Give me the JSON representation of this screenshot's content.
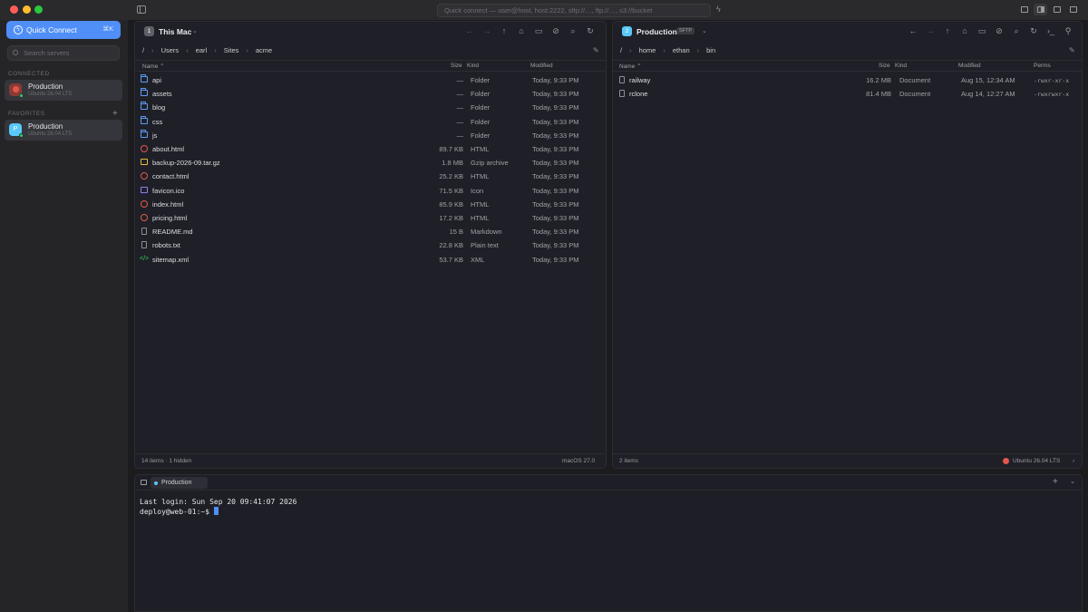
{
  "topbar": {
    "quick_connect_placeholder": "Quick connect — user@host, host:2222, sftp://…, ftp://…, s3://bucket"
  },
  "sidebar": {
    "quick_connect_label": "Quick Connect",
    "quick_connect_shortcut": "⌘K",
    "search_placeholder": "Search servers",
    "connected_header": "CONNECTED",
    "favorites_header": "FAVORITES",
    "connected": [
      {
        "name": "Production",
        "subtitle": "Ubuntu 26.04 LTS",
        "avatar_color": "#e2574c"
      }
    ],
    "favorites": [
      {
        "name": "Production",
        "subtitle": "Ubuntu 26.04 LTS",
        "avatar_letter": "P",
        "avatar_color": "#5ac8fa"
      }
    ]
  },
  "left_pane": {
    "badge": "1",
    "badge_color": "#5f6068",
    "title": "This Mac",
    "breadcrumb": [
      "/",
      "Users",
      "earl",
      "Sites",
      "acme"
    ],
    "columns": {
      "name": "Name",
      "size": "Size",
      "kind": "Kind",
      "modified": "Modified"
    },
    "files": [
      {
        "name": "api",
        "size": "—",
        "kind": "Folder",
        "modified": "Today, 9:33 PM",
        "icon": "folder-icon"
      },
      {
        "name": "assets",
        "size": "—",
        "kind": "Folder",
        "modified": "Today, 9:33 PM",
        "icon": "folder-icon"
      },
      {
        "name": "blog",
        "size": "—",
        "kind": "Folder",
        "modified": "Today, 9:33 PM",
        "icon": "folder-icon"
      },
      {
        "name": "css",
        "size": "—",
        "kind": "Folder",
        "modified": "Today, 9:33 PM",
        "icon": "folder-icon"
      },
      {
        "name": "js",
        "size": "—",
        "kind": "Folder",
        "modified": "Today, 9:33 PM",
        "icon": "folder-icon"
      },
      {
        "name": "about.html",
        "size": "89.7 KB",
        "kind": "HTML",
        "modified": "Today, 9:33 PM",
        "icon": "web-icon"
      },
      {
        "name": "backup-2026-09.tar.gz",
        "size": "1.8 MB",
        "kind": "Gzip archive",
        "modified": "Today, 9:33 PM",
        "icon": "archive-icon"
      },
      {
        "name": "contact.html",
        "size": "25.2 KB",
        "kind": "HTML",
        "modified": "Today, 9:33 PM",
        "icon": "web-icon"
      },
      {
        "name": "favicon.ico",
        "size": "71.5 KB",
        "kind": "Icon",
        "modified": "Today, 9:33 PM",
        "icon": "image-icon"
      },
      {
        "name": "index.html",
        "size": "85.9 KB",
        "kind": "HTML",
        "modified": "Today, 9:33 PM",
        "icon": "web-icon"
      },
      {
        "name": "pricing.html",
        "size": "17.2 KB",
        "kind": "HTML",
        "modified": "Today, 9:33 PM",
        "icon": "web-icon"
      },
      {
        "name": "README.md",
        "size": "15 B",
        "kind": "Markdown",
        "modified": "Today, 9:33 PM",
        "icon": "text-icon"
      },
      {
        "name": "robots.txt",
        "size": "22.8 KB",
        "kind": "Plain text",
        "modified": "Today, 9:33 PM",
        "icon": "text-icon"
      },
      {
        "name": "sitemap.xml",
        "size": "53.7 KB",
        "kind": "XML",
        "modified": "Today, 9:33 PM",
        "icon": "code-icon"
      }
    ],
    "footer_count": "14 items · 1 hidden",
    "footer_os": "macOS 27.0"
  },
  "right_pane": {
    "badge": "2",
    "badge_color": "#5ac8fa",
    "title": "Production",
    "protocol": "SFTP",
    "breadcrumb": [
      "/",
      "home",
      "ethan",
      "bin"
    ],
    "columns": {
      "name": "Name",
      "size": "Size",
      "kind": "Kind",
      "modified": "Modified",
      "perms": "Perms"
    },
    "files": [
      {
        "name": "railway",
        "size": "16.2 MB",
        "kind": "Document",
        "modified": "Aug 15, 12:34 AM",
        "perms": "-rwxr-xr-x",
        "icon": "text-icon"
      },
      {
        "name": "rclone",
        "size": "81.4 MB",
        "kind": "Document",
        "modified": "Aug 14, 12:27 AM",
        "perms": "-rwxrwxr-x",
        "icon": "text-icon"
      }
    ],
    "footer_count": "2 items",
    "footer_os": "Ubuntu 26.04 LTS",
    "os_color": "#e2574c"
  },
  "terminal": {
    "tab_label": "Production",
    "lines": [
      "Last login: Sun Sep 20 09:41:07 2026"
    ],
    "prompt": "deploy@web-01:~$ "
  }
}
